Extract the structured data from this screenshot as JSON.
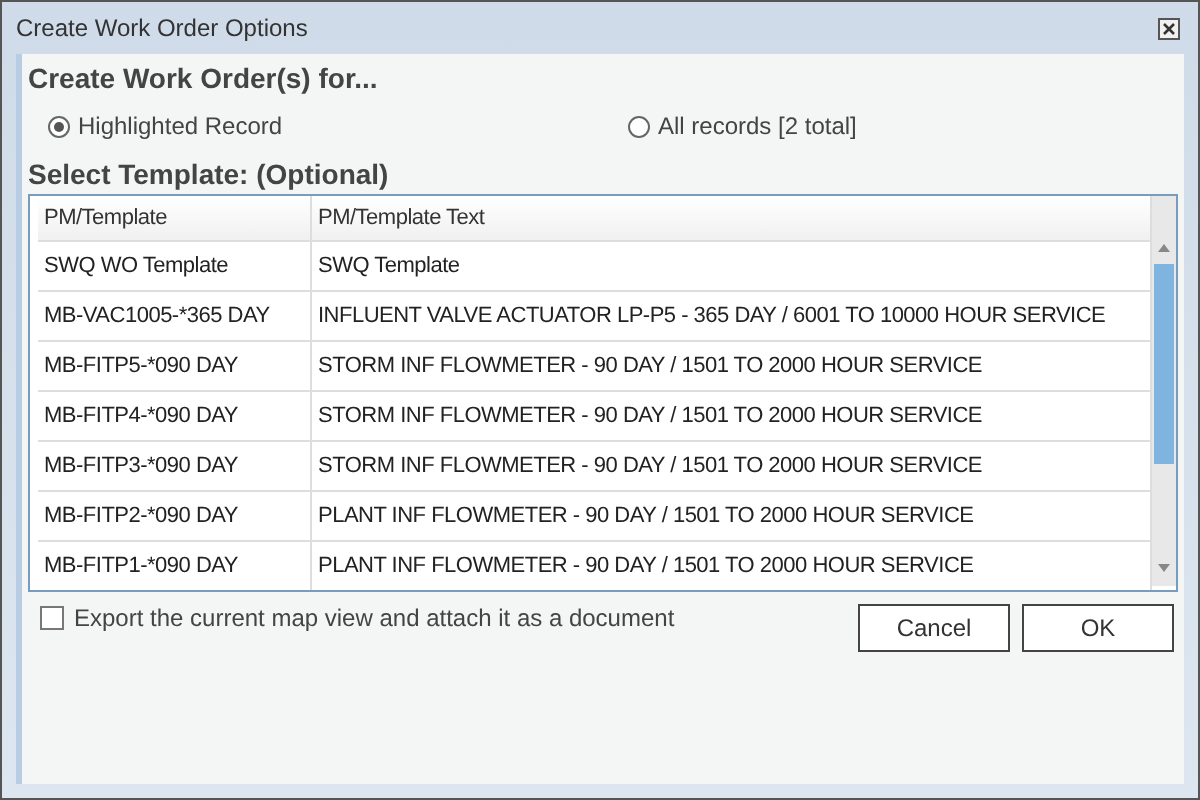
{
  "window": {
    "title": "Create Work Order Options"
  },
  "heading": "Create Work Order(s) for...",
  "scope_options": [
    {
      "label": "Highlighted Record",
      "selected": true
    },
    {
      "label": "All records [2 total]",
      "selected": false
    }
  ],
  "template_heading": "Select Template: (Optional)",
  "table": {
    "columns": [
      "PM/Template",
      "PM/Template Text"
    ],
    "rows": [
      [
        "SWQ WO Template",
        "SWQ Template"
      ],
      [
        "MB-VAC1005-*365 DAY",
        "INFLUENT VALVE ACTUATOR LP-P5 - 365 DAY / 6001 TO 10000 HOUR SERVICE"
      ],
      [
        "MB-FITP5-*090 DAY",
        "STORM INF FLOWMETER  - 90 DAY / 1501 TO 2000 HOUR SERVICE"
      ],
      [
        "MB-FITP4-*090 DAY",
        "STORM INF FLOWMETER  - 90 DAY / 1501 TO 2000 HOUR SERVICE"
      ],
      [
        "MB-FITP3-*090 DAY",
        "STORM INF FLOWMETER  - 90 DAY / 1501 TO 2000 HOUR SERVICE"
      ],
      [
        "MB-FITP2-*090 DAY",
        "PLANT INF FLOWMETER  - 90 DAY / 1501 TO 2000 HOUR SERVICE"
      ],
      [
        "MB-FITP1-*090 DAY",
        "PLANT INF FLOWMETER  - 90 DAY / 1501 TO 2000 HOUR SERVICE"
      ]
    ]
  },
  "export_option": {
    "label": "Export the current map view and attach it as a document",
    "checked": false
  },
  "buttons": [
    "Cancel",
    "OK"
  ]
}
